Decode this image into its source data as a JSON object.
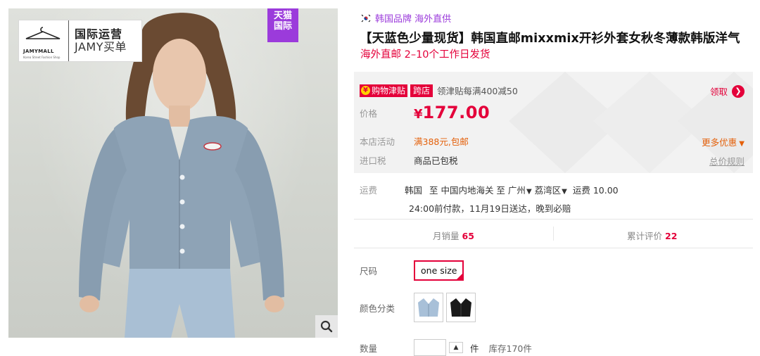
{
  "gallery": {
    "brand_line1": "国际运营",
    "brand_line2": "JAMY买单",
    "brand_logo_text": "JAMYMALL",
    "brand_logo_sub": "Korea Street Fashion Shop",
    "tmall_line1": "天猫",
    "tmall_line2": "国际",
    "zoom_icon": "search-icon"
  },
  "product": {
    "origin": "韩国品牌 海外直供",
    "title": "【天蓝色少量现货】韩国直邮mixxmix开衫外套女秋冬薄款韩版洋气",
    "subtitle": "海外直邮 2–10个工作日发货"
  },
  "promo": {
    "jintie_tag": "购物津贴",
    "kuadian_tag": "跨店",
    "jintie_rule": "领津贴每满400减50",
    "claim_label": "领取",
    "price_label": "价格",
    "price_currency": "¥",
    "price_value": "177.00",
    "activity_label": "本店活动",
    "activity_value": "满388元,包邮",
    "more_deals": "更多优惠",
    "tax_label": "进口税",
    "tax_value": "商品已包税",
    "tax_rule": "总价规则"
  },
  "shipping": {
    "label": "运费",
    "from": "韩国",
    "to_label": "至 中国内地海关 至",
    "city": "广州",
    "district": "荔湾区",
    "fee": "运费 10.00",
    "delivery": "24:00前付款，11月19日送达，晚到必赔"
  },
  "stats": {
    "monthly_label": "月销量",
    "monthly_value": "65",
    "reviews_label": "累计评价",
    "reviews_value": "22"
  },
  "options": {
    "size_label": "尺码",
    "size_value": "one size",
    "color_label": "颜色分类",
    "qty_label": "数量",
    "qty_unit": "件",
    "stock": "库存170件"
  },
  "colors": {
    "accent": "#e4003a",
    "tmall_purple": "#9b3bdb",
    "activity_orange": "#e4600a"
  }
}
